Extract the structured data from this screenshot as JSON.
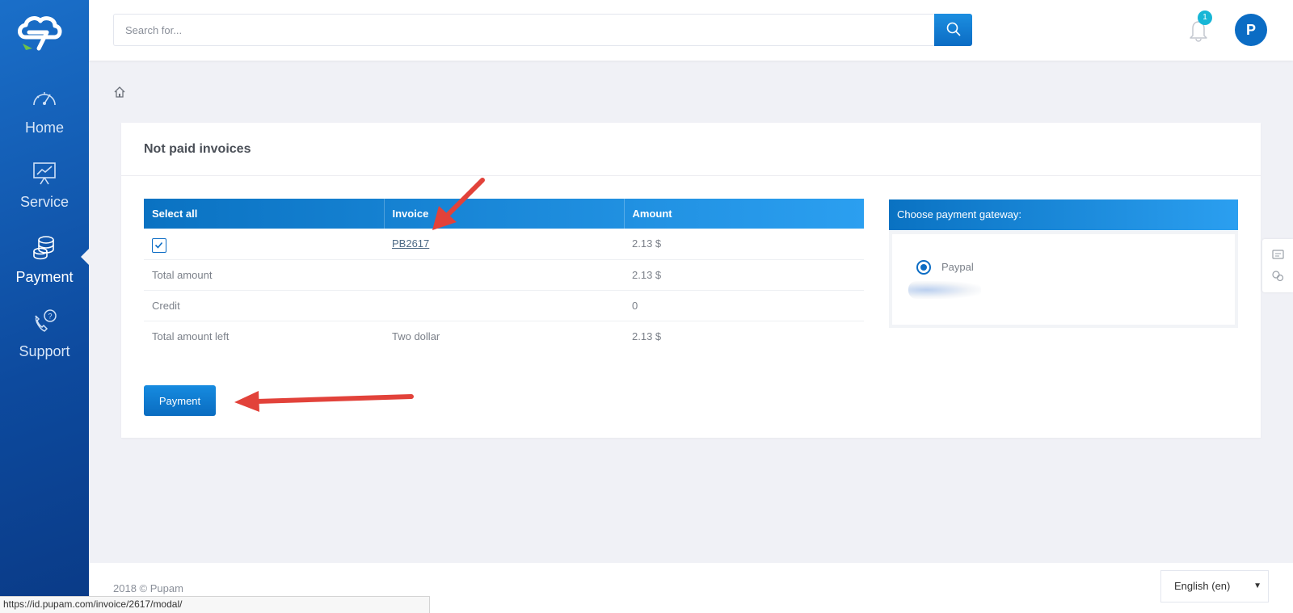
{
  "sidebar": {
    "items": [
      {
        "label": "Home",
        "icon": "speedometer-icon"
      },
      {
        "label": "Service",
        "icon": "presentation-chart-icon"
      },
      {
        "label": "Payment",
        "icon": "coins-icon"
      },
      {
        "label": "Support",
        "icon": "phone-question-icon"
      }
    ],
    "active": "Payment"
  },
  "header": {
    "search_placeholder": "Search for...",
    "notification_count": "1",
    "avatar_initial": "P"
  },
  "card": {
    "title": "Not paid invoices",
    "table": {
      "headers": [
        "Select all",
        "Invoice",
        "Amount"
      ],
      "rows": [
        {
          "invoice": "PB2617",
          "amount": "2.13 $",
          "checked": true
        },
        {
          "label": "Total amount",
          "invoice": "",
          "amount": "2.13 $"
        },
        {
          "label": "Credit",
          "invoice": "",
          "amount": "0"
        },
        {
          "label": "Total amount left",
          "invoice": "Two dollar",
          "amount": "2.13 $"
        }
      ]
    },
    "payment_button": "Payment",
    "gateway": {
      "title": "Choose payment gateway:",
      "options": [
        {
          "label": "Paypal",
          "selected": true
        }
      ]
    }
  },
  "footer": {
    "copyright": "2018 © Pupam",
    "language": "English (en)"
  },
  "status_url": "https://id.pupam.com/invoice/2617/modal/",
  "colors": {
    "sidebar": "#0d4a9e",
    "accent": "#0b6cc4",
    "badge": "#17b6d6",
    "annotation_arrow": "#e2423a"
  }
}
